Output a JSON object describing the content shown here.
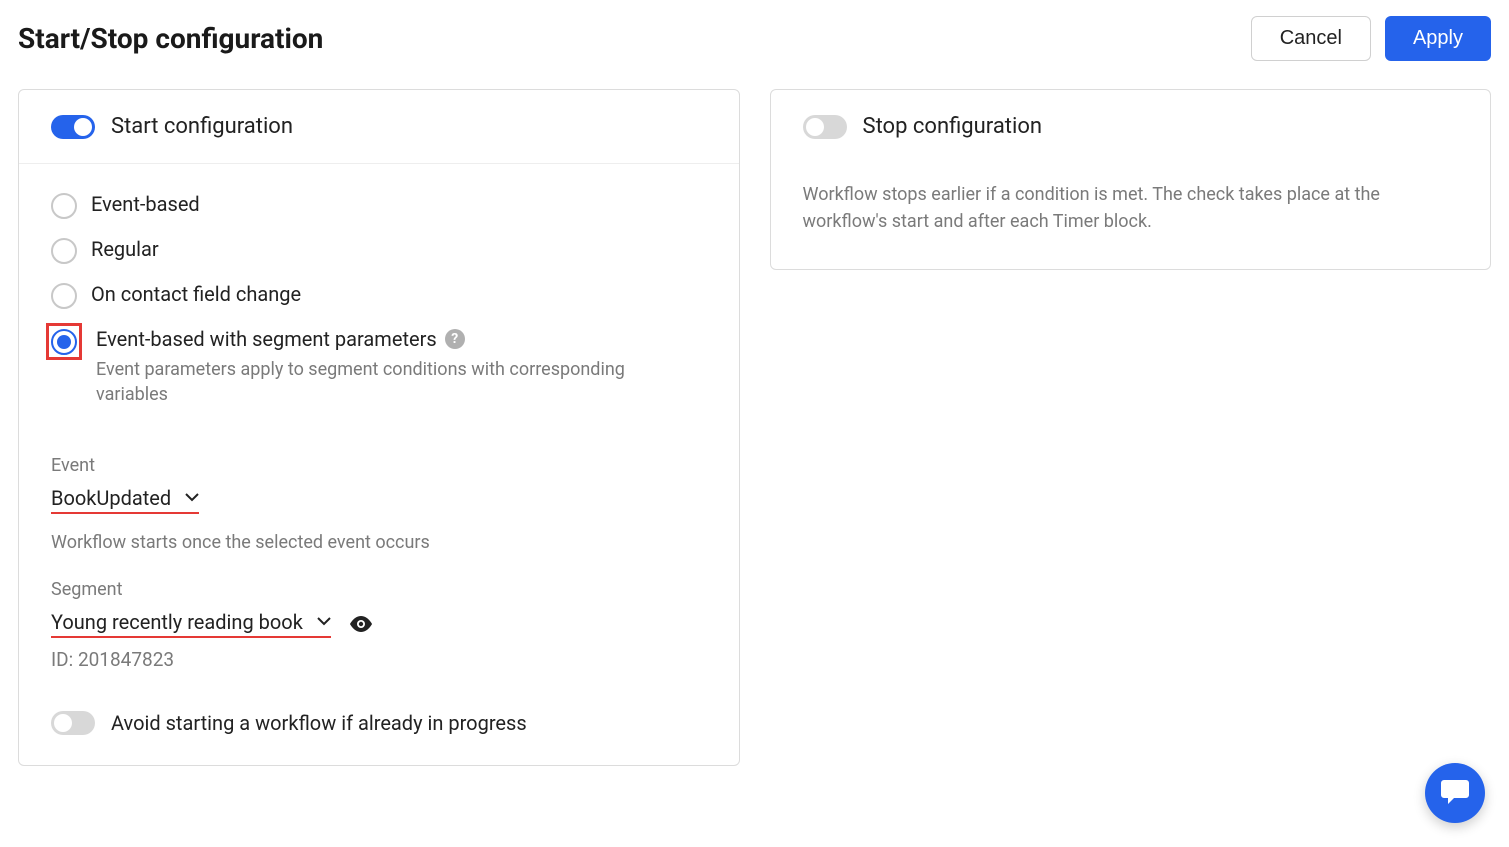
{
  "header": {
    "title": "Start/Stop configuration",
    "cancel": "Cancel",
    "apply": "Apply"
  },
  "start": {
    "title": "Start configuration",
    "radios": {
      "event_based": "Event-based",
      "regular": "Regular",
      "on_change": "On contact field change",
      "event_segment": "Event-based with segment parameters",
      "event_segment_desc": "Event parameters apply to segment conditions with corresponding variables"
    },
    "event": {
      "label": "Event",
      "value": "BookUpdated",
      "hint": "Workflow starts once the selected event occurs"
    },
    "segment": {
      "label": "Segment",
      "value": "Young recently reading book",
      "id_label": "ID: 201847823"
    },
    "avoid": "Avoid starting a workflow if already in progress"
  },
  "stop": {
    "title": "Stop configuration",
    "desc": "Workflow stops earlier if a condition is met. The check takes place at the workflow's start and after each Timer block."
  }
}
